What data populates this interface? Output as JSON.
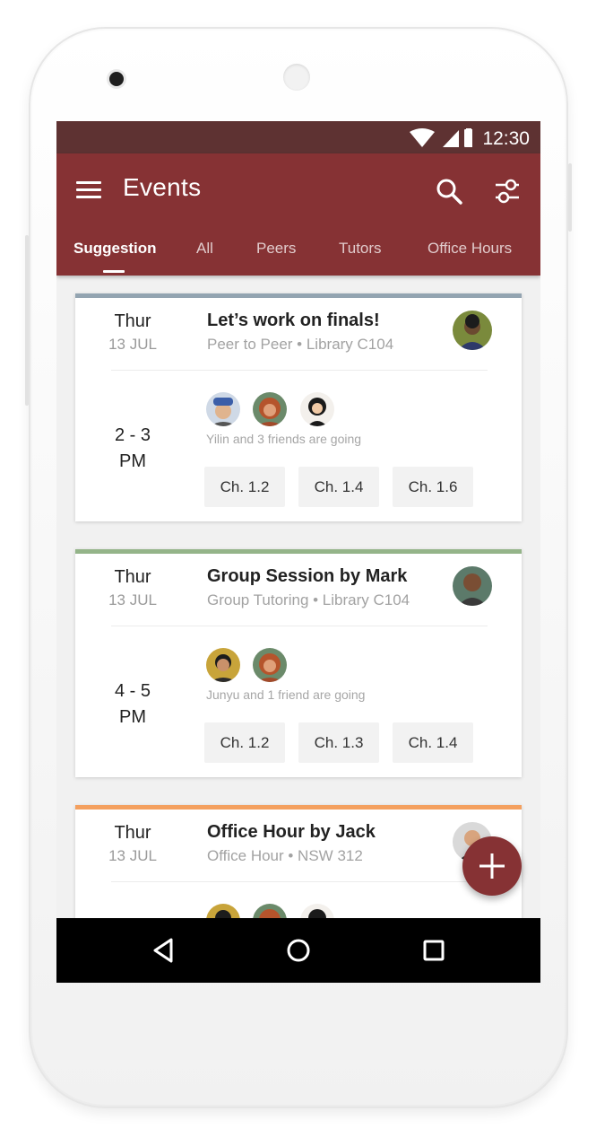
{
  "status_bar": {
    "time": "12:30"
  },
  "app_bar": {
    "title": "Events"
  },
  "tabs": [
    {
      "label": "Suggestion",
      "active": true
    },
    {
      "label": "All",
      "active": false
    },
    {
      "label": "Peers",
      "active": false
    },
    {
      "label": "Tutors",
      "active": false
    },
    {
      "label": "Office Hours",
      "active": false
    }
  ],
  "events": [
    {
      "accent_color": "#93a4b1",
      "day": "Thur",
      "date": "13 JUL",
      "title": "Let’s work on finals!",
      "subtitle": "Peer to Peer • Library C104",
      "time_line1": "2 - 3",
      "time_line2": "PM",
      "going": "Yilin and 3 friends are going",
      "chips": [
        "Ch. 1.2",
        "Ch. 1.4",
        "Ch. 1.6"
      ]
    },
    {
      "accent_color": "#94b489",
      "day": "Thur",
      "date": "13 JUL",
      "title": "Group Session by Mark",
      "subtitle": "Group Tutoring • Library C104",
      "time_line1": "4 - 5",
      "time_line2": "PM",
      "going": "Junyu and 1 friend are going",
      "chips": [
        "Ch. 1.2",
        "Ch. 1.3",
        "Ch. 1.4"
      ]
    },
    {
      "accent_color": "#f4a05f",
      "day": "Thur",
      "date": "13 JUL",
      "title": "Office Hour by Jack",
      "subtitle": "Office Hour • NSW 312"
    }
  ],
  "colors": {
    "primary": "#863234",
    "status_bar": "#5e3232",
    "background": "#f1f1f1"
  },
  "icons": [
    "menu-icon",
    "search-icon",
    "filter-icon",
    "add-icon",
    "back-icon",
    "home-icon",
    "recents-icon",
    "wifi-icon",
    "signal-icon",
    "battery-icon"
  ]
}
